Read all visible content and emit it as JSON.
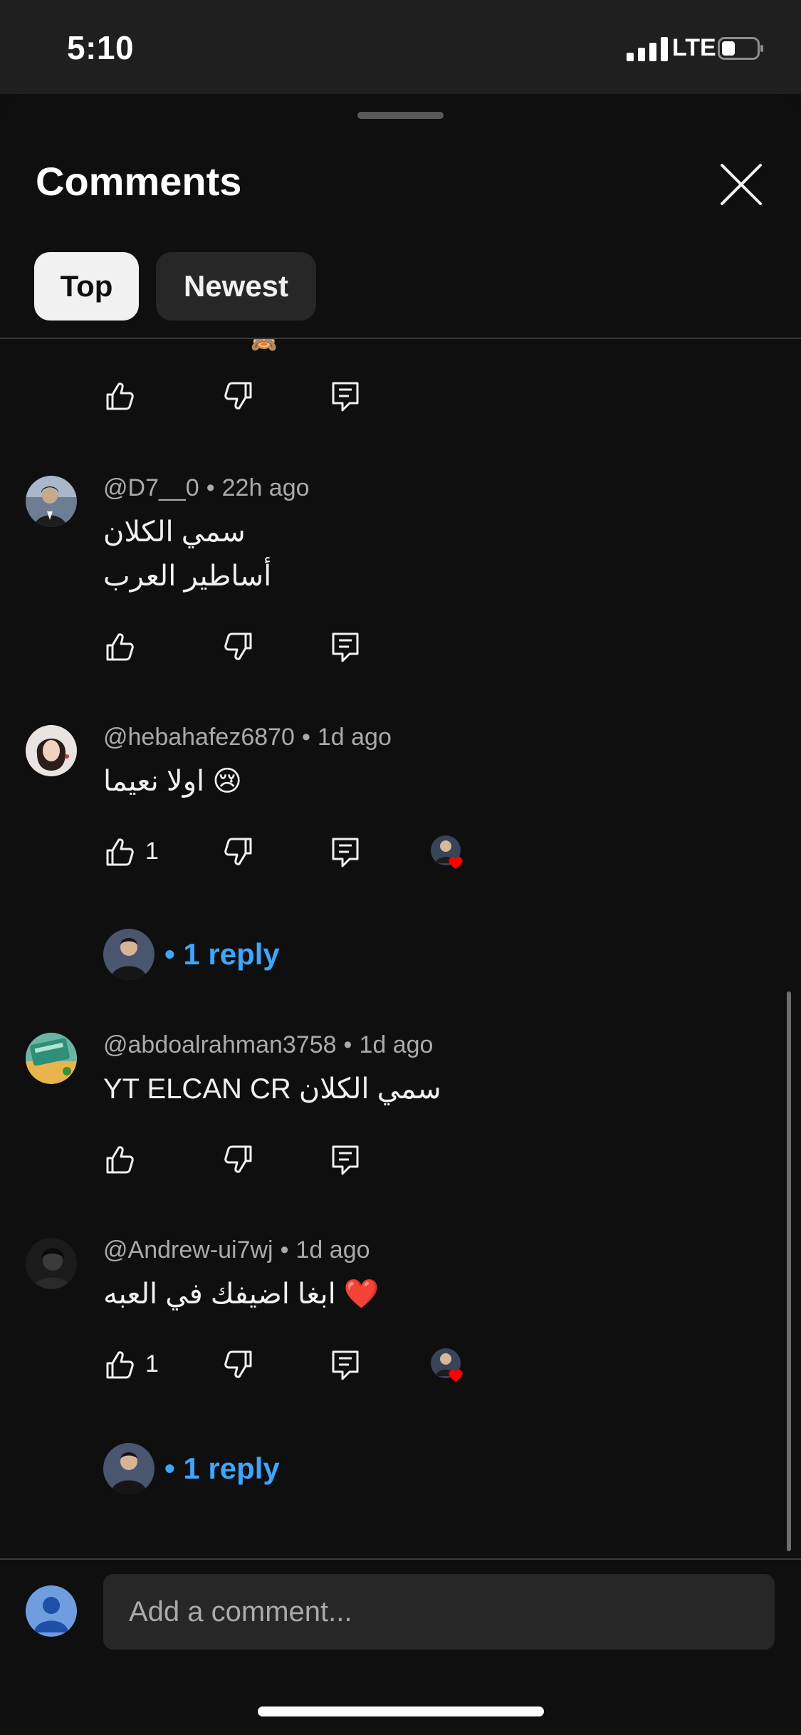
{
  "status_bar": {
    "time": "5:10",
    "network": "LTE"
  },
  "header": {
    "title": "Comments",
    "filters": {
      "top": "Top",
      "newest": "Newest"
    }
  },
  "comments": [
    {
      "handle": "@D7__0",
      "age": "22h ago",
      "text": "سمي الكلان\nأساطير العرب",
      "likes": ""
    },
    {
      "handle": "@hebahafez6870",
      "age": "1d ago",
      "text": "اولا نعيما 😢",
      "likes": "1",
      "hearted": true,
      "replies": "1 reply"
    },
    {
      "handle": "@abdoalrahman3758",
      "age": "1d ago",
      "text": "YT ELCAN CR سمي الكلان",
      "likes": ""
    },
    {
      "handle": "@Andrew-ui7wj",
      "age": "1d ago",
      "text": "ابغا اضيفك في العبه ❤️",
      "likes": "1",
      "hearted": true,
      "replies": "1 reply"
    }
  ],
  "composer": {
    "placeholder": "Add a comment..."
  },
  "icons": [
    "like-icon",
    "dislike-icon",
    "reply-icon",
    "close-icon",
    "creator-heart-icon"
  ],
  "colors": {
    "background": "#0f0f0f",
    "link": "#3ea6ff",
    "heart": "#ff0000"
  }
}
